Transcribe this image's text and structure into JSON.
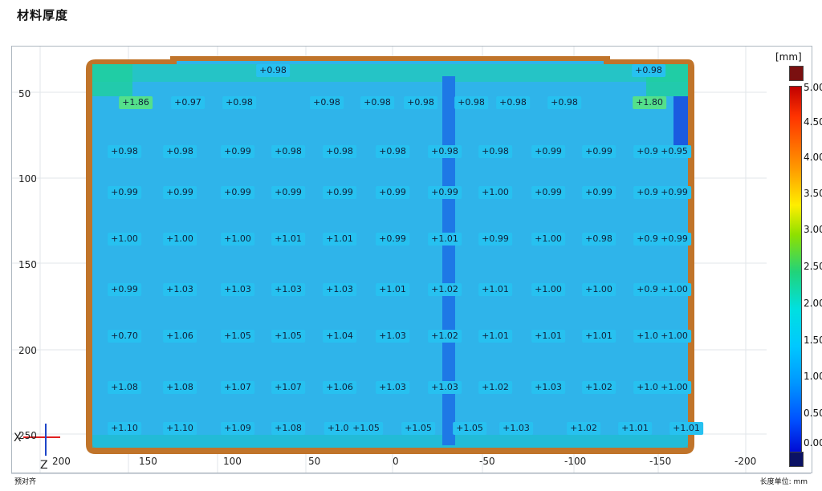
{
  "page_title": "材料厚度",
  "colorbar": {
    "unit": "[mm]",
    "ticks": [
      "5.00",
      "4.50",
      "4.00",
      "3.50",
      "3.00",
      "2.50",
      "2.00",
      "1.50",
      "1.00",
      "0.50",
      "0.00"
    ]
  },
  "axes": {
    "y_ticks": [
      "50",
      "100",
      "150",
      "200",
      "250"
    ],
    "x_ticks": [
      "200",
      "150",
      "100",
      "50",
      "0",
      "-50",
      "-100",
      "-150",
      "-200"
    ],
    "axis_x_label": "X",
    "axis_z_label": "Z"
  },
  "rows": [
    [
      "+0.98",
      "+0.98"
    ],
    [
      "+1.86",
      "+0.97",
      "+0.98",
      "+0.98",
      "+0.98",
      "+0.98",
      "+0.98",
      "+0.98",
      "+0.98",
      "+1.80"
    ],
    [
      "+0.98",
      "+0.98",
      "+0.99",
      "+0.98",
      "+0.98",
      "+0.98",
      "+0.98",
      "+0.98",
      "+0.99",
      "+0.99",
      "+0.99",
      "+0.95"
    ],
    [
      "+0.99",
      "+0.99",
      "+0.99",
      "+0.99",
      "+0.99",
      "+0.99",
      "+0.99",
      "+1.00",
      "+0.99",
      "+0.99",
      "+0.99",
      "+0.99"
    ],
    [
      "+1.00",
      "+1.00",
      "+1.00",
      "+1.01",
      "+1.01",
      "+0.99",
      "+1.01",
      "+0.99",
      "+1.00",
      "+0.98",
      "+0.99",
      "+0.99"
    ],
    [
      "+0.99",
      "+1.03",
      "+1.03",
      "+1.03",
      "+1.03",
      "+1.01",
      "+1.02",
      "+1.01",
      "+1.00",
      "+1.00",
      "+0.99",
      "+1.00"
    ],
    [
      "+0.70",
      "+1.06",
      "+1.05",
      "+1.05",
      "+1.04",
      "+1.03",
      "+1.02",
      "+1.01",
      "+1.01",
      "+1.01",
      "+1.01",
      "+1.00"
    ],
    [
      "+1.08",
      "+1.08",
      "+1.07",
      "+1.07",
      "+1.06",
      "+1.03",
      "+1.03",
      "+1.02",
      "+1.03",
      "+1.02",
      "+1.01",
      "+1.00"
    ],
    [
      "+1.10",
      "+1.10",
      "+1.09",
      "+1.08",
      "+1.0:",
      "+1.05",
      "+1.05",
      "+1.05",
      "+1.03",
      "+1.02",
      "+1.01",
      "+1.01"
    ]
  ],
  "status_left": "预对齐",
  "status_right": "长度单位: mm"
}
